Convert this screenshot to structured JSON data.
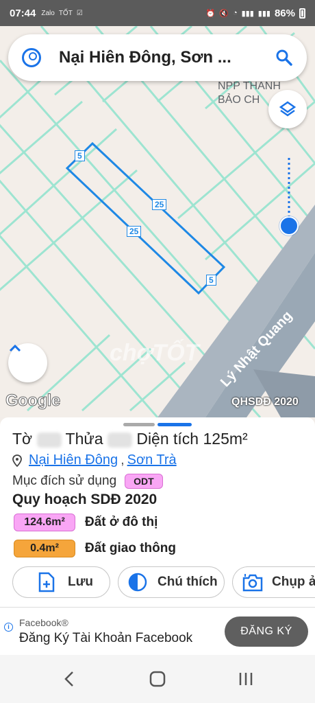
{
  "status_bar": {
    "time": "07:44",
    "notif_icons": [
      "zalo-icon",
      "tot-icon",
      "check-icon"
    ],
    "right_icons": [
      "alarm-icon",
      "mute-icon",
      "wifi-icon",
      "signal-lte1-icon",
      "signal-lte2-icon"
    ],
    "battery": "86%"
  },
  "search": {
    "title": "Nại Hiên Đông, Sơn ..."
  },
  "map": {
    "poi_label_line1": "NPP THANH",
    "poi_label_line2": "BẢO CH",
    "edge_labels": {
      "top": "5",
      "right": "25",
      "left": "25",
      "bottom": "5"
    },
    "street_name": "Lý Nhật Quang",
    "watermark": "chợTỐT",
    "google_logo": "Google",
    "layer_label": "QHSDĐ 2020",
    "parcel_color": "#1e88e5",
    "grid_color": "#7be0c8"
  },
  "parcel": {
    "to_label": "Tờ",
    "thua_label": "Thửa",
    "area_text": "Diện tích 125m²",
    "ward": "Nại Hiên Đông",
    "separator": ",",
    "district": "Sơn Trà",
    "purpose_label": "Mục đích sử dụng",
    "purpose_code": "ODT",
    "plan_title": "Quy hoạch SDĐ 2020",
    "legend": [
      {
        "area": "124.6m²",
        "label": "Đất ở đô thị",
        "color": "#f9a6f5"
      },
      {
        "area": "0.4m²",
        "label": "Đất giao thông",
        "color": "#f5a53b"
      }
    ]
  },
  "actions": [
    {
      "label": "Lưu",
      "icon": "add-file-icon"
    },
    {
      "label": "Chú thích",
      "icon": "half-circle-icon"
    },
    {
      "label": "Chụp ả",
      "icon": "camera-plus-icon"
    }
  ],
  "ad": {
    "sponsor": "Facebook®",
    "headline": "Đăng Ký Tài Khoản Facebook",
    "cta": "ĐĂNG KÝ"
  },
  "nav": [
    "back-icon",
    "home-icon",
    "recents-icon"
  ]
}
